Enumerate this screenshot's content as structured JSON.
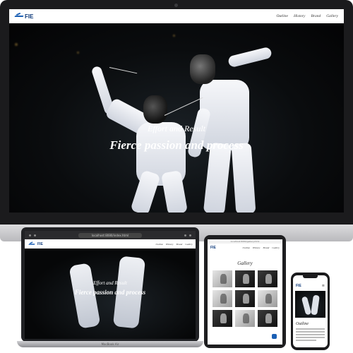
{
  "site": {
    "logo_text": "FIE",
    "nav": [
      "Outline",
      "History",
      "Brand",
      "Gallery"
    ]
  },
  "hero": {
    "subtitle": "Effort and Result",
    "title": "Fierce passion and process"
  },
  "laptop": {
    "url": "localhost:8080/index.html",
    "brand_label": "MacBook Air"
  },
  "tablet": {
    "url": "localhost:8080/gallery.html",
    "gallery_title": "Gallery"
  },
  "phone": {
    "section_title": "Outline"
  },
  "colors": {
    "brand_blue": "#1a5fb4",
    "device_frame": "#1b1b1d",
    "hero_bg": "#0a0c0e"
  }
}
